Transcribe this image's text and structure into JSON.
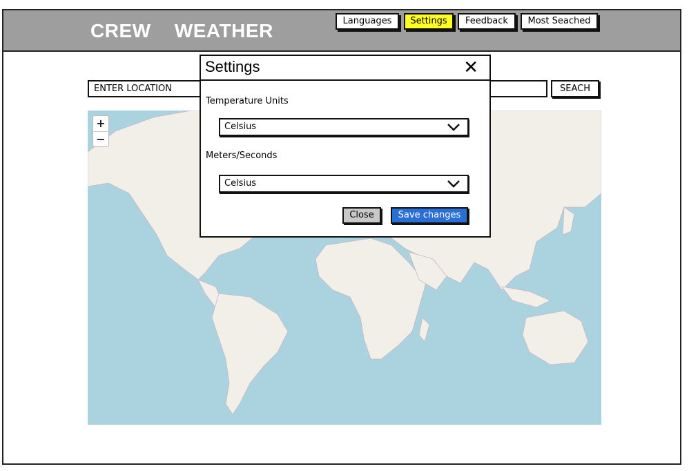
{
  "app": {
    "logo_text": "CREW WEATHER"
  },
  "nav": {
    "items": [
      {
        "label": "Languages",
        "active": false
      },
      {
        "label": "Settings",
        "active": true
      },
      {
        "label": "Feedback",
        "active": false
      },
      {
        "label": "Most Seached",
        "active": false
      }
    ]
  },
  "search": {
    "value": "ENTER LOCATION",
    "button_label": "SEACH"
  },
  "map": {
    "zoom_in": "+",
    "zoom_out": "−",
    "ocean_color": "#aad3df",
    "land_color": "#f2efe9"
  },
  "settings_modal": {
    "title": "Settings",
    "close_glyph": "✕",
    "temperature_label": "Temperature Units",
    "temperature_value": "Celsius",
    "speed_label": "Meters/Seconds",
    "speed_value": "Celsius",
    "close_button": "Close",
    "save_button": "Save changes"
  },
  "colors": {
    "header": "#9e9e9e",
    "active_nav": "#ffff22",
    "save_button": "#2a6fd6"
  }
}
